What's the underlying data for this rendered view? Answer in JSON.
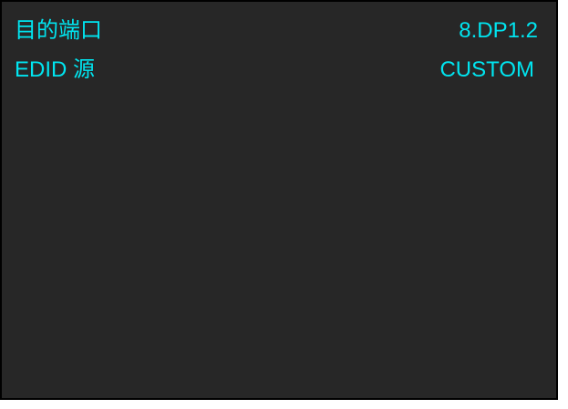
{
  "colors": {
    "background": "#272727",
    "text": "#00E5F0",
    "border": "#000000"
  },
  "rows": [
    {
      "label": "目的端口",
      "value": "8.DP1.2"
    },
    {
      "label": "EDID 源",
      "value": "CUSTOM"
    }
  ]
}
